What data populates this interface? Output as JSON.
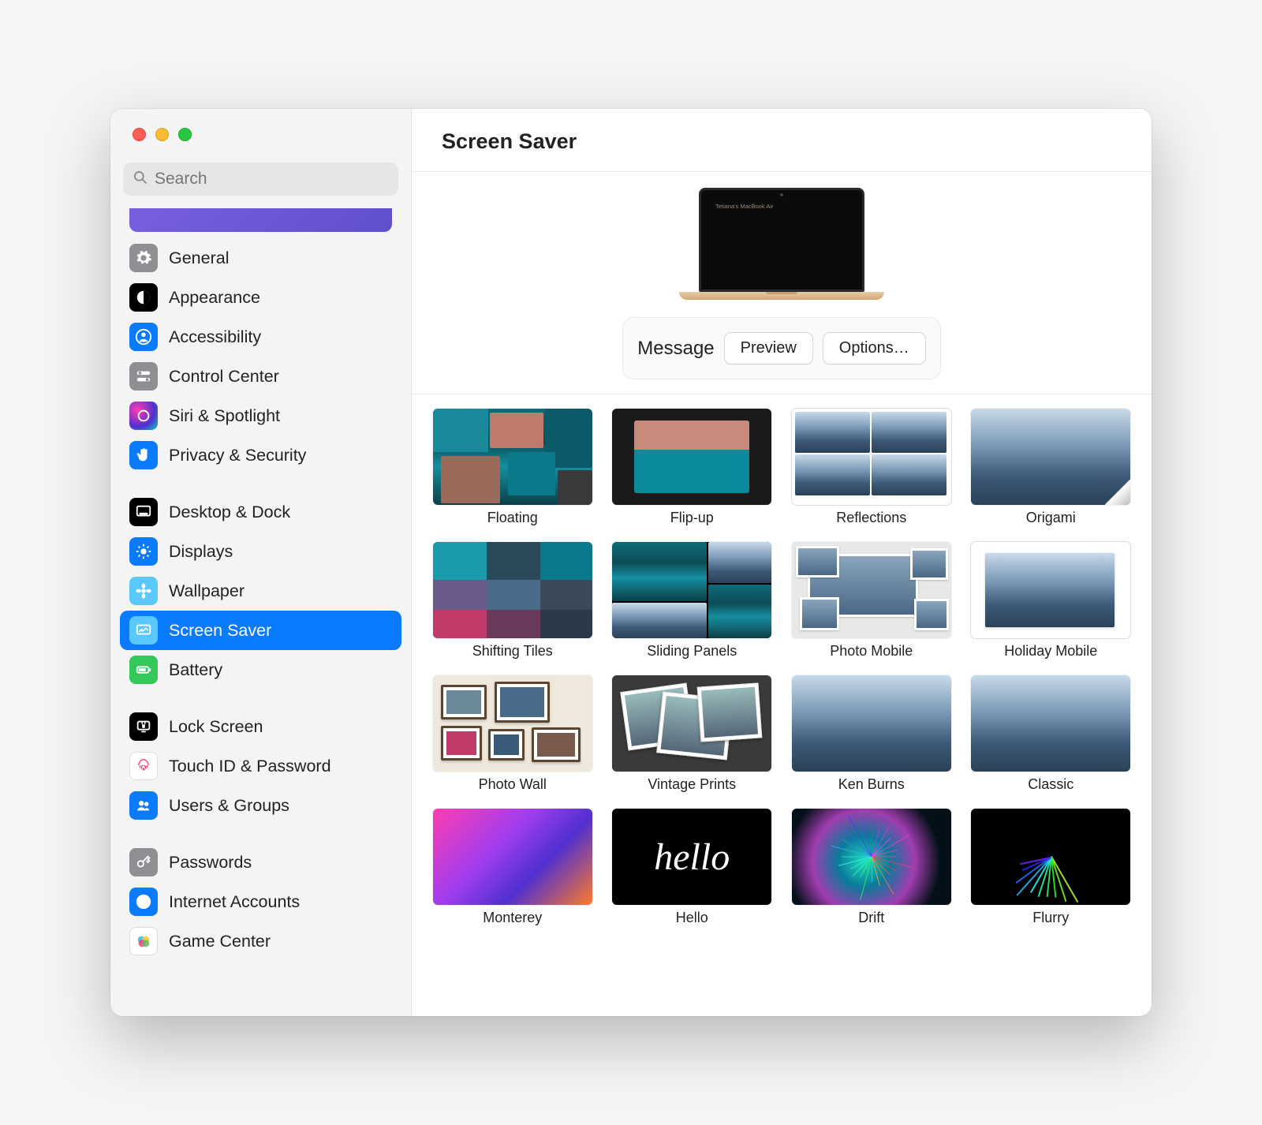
{
  "header": {
    "title": "Screen Saver"
  },
  "search": {
    "placeholder": "Search"
  },
  "sidebar": {
    "groups": [
      {
        "items": [
          {
            "id": "general",
            "label": "General",
            "icon": "gear",
            "bg": "#8e8e93"
          },
          {
            "id": "appearance",
            "label": "Appearance",
            "icon": "contrast",
            "bg": "#000000"
          },
          {
            "id": "accessibility",
            "label": "Accessibility",
            "icon": "person",
            "bg": "#0a7aff"
          },
          {
            "id": "control-center",
            "label": "Control Center",
            "icon": "switches",
            "bg": "#8e8e93"
          },
          {
            "id": "siri",
            "label": "Siri & Spotlight",
            "icon": "siri",
            "bg": "siri"
          },
          {
            "id": "privacy",
            "label": "Privacy & Security",
            "icon": "hand",
            "bg": "#0a7aff"
          }
        ]
      },
      {
        "items": [
          {
            "id": "desktop-dock",
            "label": "Desktop & Dock",
            "icon": "dock",
            "bg": "#000000"
          },
          {
            "id": "displays",
            "label": "Displays",
            "icon": "sun",
            "bg": "#0a7aff"
          },
          {
            "id": "wallpaper",
            "label": "Wallpaper",
            "icon": "flower",
            "bg": "#5ac8fa"
          },
          {
            "id": "screen-saver",
            "label": "Screen Saver",
            "icon": "screensaver",
            "bg": "#5ac8fa",
            "selected": true
          },
          {
            "id": "battery",
            "label": "Battery",
            "icon": "battery",
            "bg": "#34c759"
          }
        ]
      },
      {
        "items": [
          {
            "id": "lock-screen",
            "label": "Lock Screen",
            "icon": "lock",
            "bg": "#000000"
          },
          {
            "id": "touch-id",
            "label": "Touch ID & Password",
            "icon": "fingerprint",
            "bg": "#ffffff"
          },
          {
            "id": "users",
            "label": "Users & Groups",
            "icon": "users",
            "bg": "#0a7aff"
          }
        ]
      },
      {
        "items": [
          {
            "id": "passwords",
            "label": "Passwords",
            "icon": "key",
            "bg": "#8e8e93"
          },
          {
            "id": "internet-accounts",
            "label": "Internet Accounts",
            "icon": "at",
            "bg": "#0a7aff"
          },
          {
            "id": "game-center",
            "label": "Game Center",
            "icon": "gamecenter",
            "bg": "#ffffff"
          }
        ]
      }
    ]
  },
  "preview": {
    "device_label": "Tetiana's MacBook Air"
  },
  "controls": {
    "current_name": "Message",
    "preview_button": "Preview",
    "options_button": "Options…"
  },
  "savers": [
    {
      "label": "Floating",
      "style": "floating"
    },
    {
      "label": "Flip-up",
      "style": "flipup"
    },
    {
      "label": "Reflections",
      "style": "reflections"
    },
    {
      "label": "Origami",
      "style": "origami"
    },
    {
      "label": "Shifting Tiles",
      "style": "shifting"
    },
    {
      "label": "Sliding Panels",
      "style": "sliding"
    },
    {
      "label": "Photo Mobile",
      "style": "photomobile"
    },
    {
      "label": "Holiday Mobile",
      "style": "holidaymobile"
    },
    {
      "label": "Photo Wall",
      "style": "photowall"
    },
    {
      "label": "Vintage Prints",
      "style": "vintage"
    },
    {
      "label": "Ken Burns",
      "style": "kenburns"
    },
    {
      "label": "Classic",
      "style": "classic"
    },
    {
      "label": "Monterey",
      "style": "monterey"
    },
    {
      "label": "Hello",
      "style": "hello"
    },
    {
      "label": "Drift",
      "style": "drift"
    },
    {
      "label": "Flurry",
      "style": "flurry"
    }
  ]
}
